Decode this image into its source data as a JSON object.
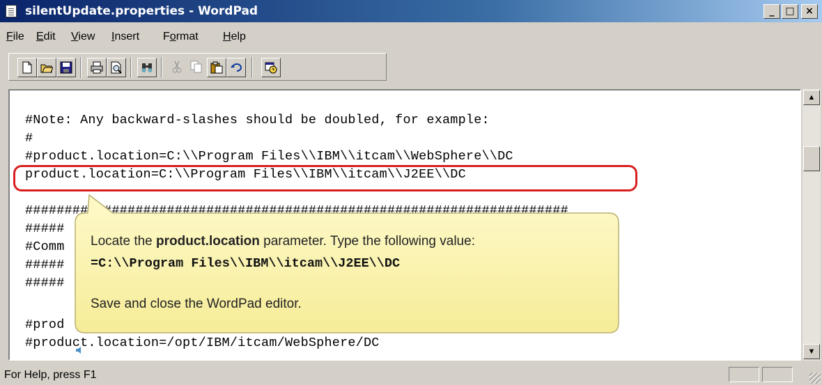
{
  "window": {
    "title": "silentUpdate.properties - WordPad",
    "controls": {
      "minimize": "_",
      "maximize": "□",
      "close": "×"
    }
  },
  "menu": [
    {
      "label": "File",
      "mnemonic_index": 0
    },
    {
      "label": "Edit",
      "mnemonic_index": 0
    },
    {
      "label": "View",
      "mnemonic_index": 0
    },
    {
      "label": "Insert",
      "mnemonic_index": 0
    },
    {
      "label": "Format",
      "mnemonic_index": 1
    },
    {
      "label": "Help",
      "mnemonic_index": 0
    }
  ],
  "toolbar": {
    "buttons": [
      "new-icon",
      "open-icon",
      "save-icon",
      "print-icon",
      "print-preview-icon",
      "find-icon",
      "cut-icon",
      "copy-icon",
      "paste-icon",
      "undo-icon",
      "date-time-icon"
    ]
  },
  "document": {
    "lines": [
      "#Note: Any backward-slashes should be doubled, for example:",
      "#",
      "#product.location=C:\\\\Program Files\\\\IBM\\\\itcam\\\\WebSphere\\\\DC",
      "product.location=C:\\\\Program Files\\\\IBM\\\\itcam\\\\J2EE\\\\DC",
      "",
      "#####################################################################",
      "#####",
      "#Comm",
      "#####                                                  ###############",
      "#####",
      "",
      "#prod",
      "#product.location=/opt/IBM/itcam/WebSphere/DC"
    ]
  },
  "callout": {
    "text_prefix": "Locate the ",
    "text_bold": "product.location",
    "text_suffix": " parameter. Type the following value:",
    "value": "=C:\\\\Program Files\\\\IBM\\\\itcam\\\\J2EE\\\\DC",
    "instruction": "Save and close the WordPad editor."
  },
  "status": {
    "text": "For Help, press F1"
  },
  "colors": {
    "highlight": "#d81e1e",
    "callout_fill": "#fcf6b4",
    "callout_border": "#b8b070",
    "titlebar": "#0a246a"
  }
}
